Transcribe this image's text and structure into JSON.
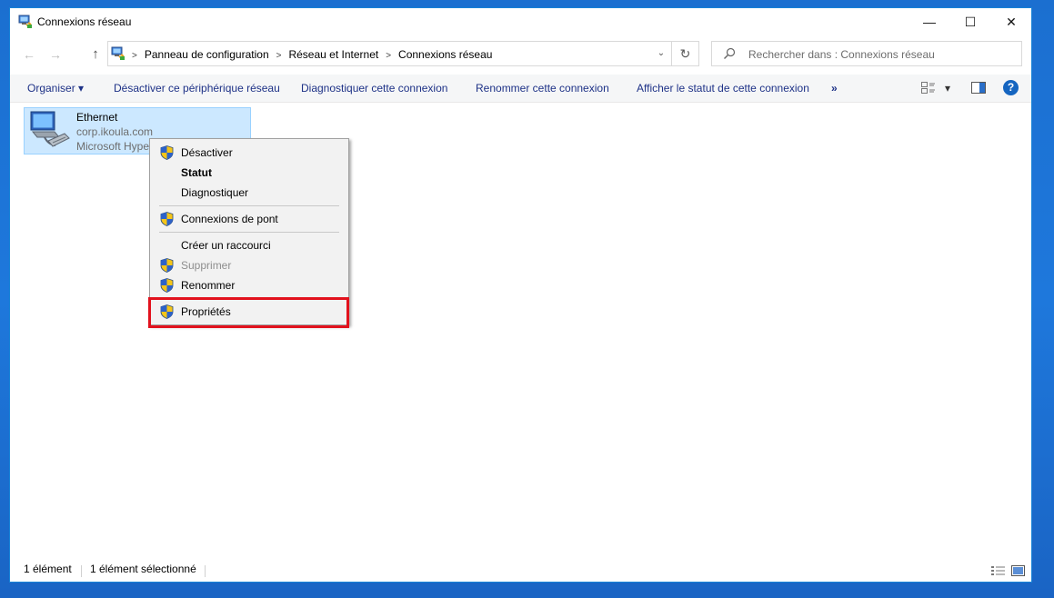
{
  "window": {
    "title": "Connexions réseau",
    "minimize_glyph": "—",
    "maximize_glyph": "☐",
    "close_glyph": "✕"
  },
  "nav": {
    "back_glyph": "←",
    "forward_glyph": "→",
    "up_glyph": "↑",
    "breadcrumb": [
      "Panneau de configuration",
      "Réseau et Internet",
      "Connexions réseau"
    ],
    "breadcrumb_sep": ">",
    "dropdown_glyph": "⌄",
    "refresh_glyph": "↻"
  },
  "search": {
    "placeholder": "Rechercher dans : Connexions réseau"
  },
  "toolbar": {
    "organize": "Organiser",
    "organize_caret": "▾",
    "commands": [
      "Désactiver ce périphérique réseau",
      "Diagnostiquer cette connexion",
      "Renommer cette connexion",
      "Afficher le statut de cette connexion"
    ],
    "more": "»",
    "view_caret": "▾",
    "help": "?"
  },
  "item": {
    "name": "Ethernet",
    "domain": "corp.ikoula.com",
    "adapter": "Microsoft Hype"
  },
  "context_menu": {
    "items": [
      {
        "label": "Désactiver",
        "shield": true
      },
      {
        "label": "Statut",
        "bold": true
      },
      {
        "label": "Diagnostiquer"
      },
      {
        "label": "Connexions de pont",
        "shield": true
      },
      {
        "label": "Créer un raccourci"
      },
      {
        "label": "Supprimer",
        "shield": true,
        "disabled": true
      },
      {
        "label": "Renommer",
        "shield": true
      },
      {
        "label": "Propriétés",
        "shield": true
      }
    ]
  },
  "status": {
    "count": "1 élément",
    "selected": "1 élément sélectionné"
  },
  "colors": {
    "accent": "#1e3287",
    "selection": "#cce8ff",
    "highlight_border": "#e2121d",
    "desktop": "#1e78dc"
  },
  "icons": {
    "title": "network-connections-icon",
    "item": "ethernet-adapter-icon",
    "menu": "uac-shield-icon"
  }
}
